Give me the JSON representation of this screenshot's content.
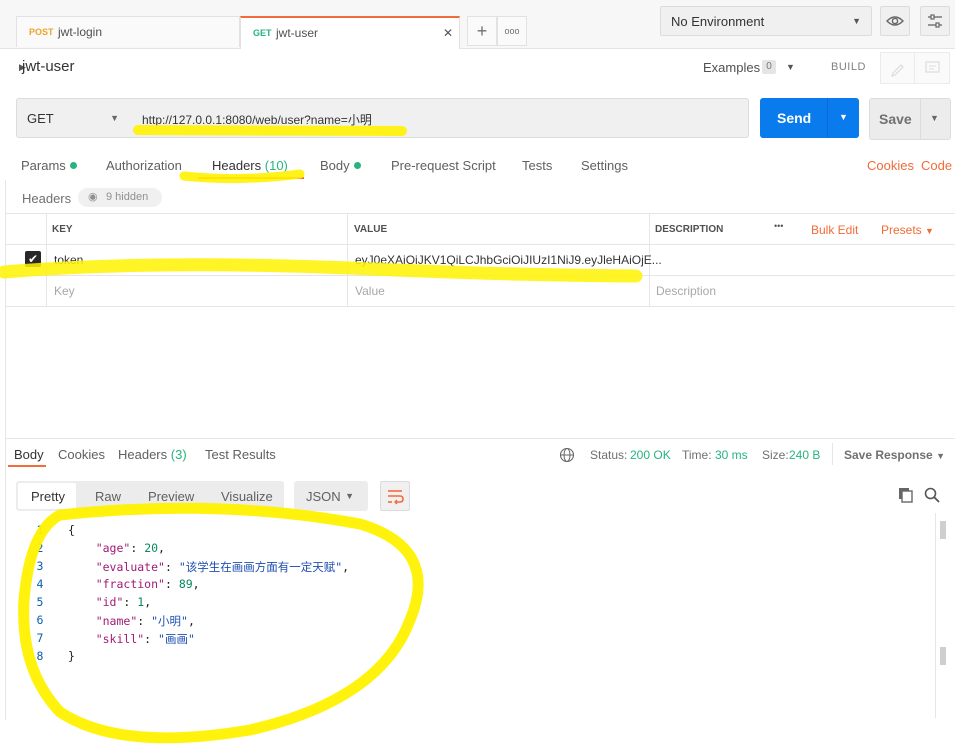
{
  "tabs": [
    {
      "method": "POST",
      "name": "jwt-login",
      "method_color": "#f0a32a"
    },
    {
      "method": "GET",
      "name": "jwt-user",
      "method_color": "#26b47f"
    }
  ],
  "tab_close": "✕",
  "tab_add": "+",
  "tab_more": "ooo",
  "environment": "No Environment",
  "request_name": "jwt-user",
  "examples_label": "Examples",
  "examples_count": "0",
  "build_label": "BUILD",
  "method": "GET",
  "url": "http://127.0.0.1:8080/web/user?name=小明",
  "send_label": "Send",
  "save_label": "Save",
  "request_tabs": {
    "params": "Params",
    "authorization": "Authorization",
    "headers": "Headers",
    "headers_count": "(10)",
    "body": "Body",
    "prerequest": "Pre-request Script",
    "tests": "Tests",
    "settings": "Settings",
    "cookies": "Cookies",
    "code": "Code"
  },
  "headers_section": {
    "label": "Headers",
    "hidden": "9 hidden",
    "col_key": "KEY",
    "col_value": "VALUE",
    "col_description": "DESCRIPTION",
    "more": "•••",
    "bulk_edit": "Bulk Edit",
    "presets": "Presets",
    "rows": [
      {
        "key": "token",
        "value": "eyJ0eXAiOiJKV1QiLCJhbGciOiJIUzI1NiJ9.eyJleHAiOjE..."
      }
    ],
    "placeholder_key": "Key",
    "placeholder_value": "Value",
    "placeholder_description": "Description"
  },
  "response_tabs": {
    "body": "Body",
    "cookies": "Cookies",
    "headers": "Headers",
    "headers_count": "(3)",
    "test_results": "Test Results"
  },
  "response_meta": {
    "status_label": "Status:",
    "status_value": "200 OK",
    "time_label": "Time:",
    "time_value": "30 ms",
    "size_label": "Size:",
    "size_value": "240 B",
    "save_response": "Save Response"
  },
  "format_tabs": {
    "pretty": "Pretty",
    "raw": "Raw",
    "preview": "Preview",
    "visualize": "Visualize",
    "language": "JSON"
  },
  "response_body": {
    "line_numbers": [
      "1",
      "2",
      "3",
      "4",
      "5",
      "6",
      "7",
      "8"
    ],
    "open": "{",
    "close": "}",
    "fields": [
      {
        "key": "\"age\"",
        "value": "20",
        "type": "num"
      },
      {
        "key": "\"evaluate\"",
        "value": "\"该学生在画画方面有一定天赋\"",
        "type": "str"
      },
      {
        "key": "\"fraction\"",
        "value": "89",
        "type": "num"
      },
      {
        "key": "\"id\"",
        "value": "1",
        "type": "num"
      },
      {
        "key": "\"name\"",
        "value": "\"小明\"",
        "type": "str"
      },
      {
        "key": "\"skill\"",
        "value": "\"画画\"",
        "type": "str"
      }
    ]
  },
  "colors": {
    "accent": "#f26b3a",
    "send": "#097bed",
    "success": "#26b47f",
    "highlight": "#fff200"
  },
  "icons": [
    "eye-icon",
    "sliders-icon",
    "pencil-icon",
    "comment-icon",
    "caret-right-icon",
    "globe-icon",
    "copy-icon",
    "search-icon",
    "wrap-icon",
    "check-icon"
  ]
}
